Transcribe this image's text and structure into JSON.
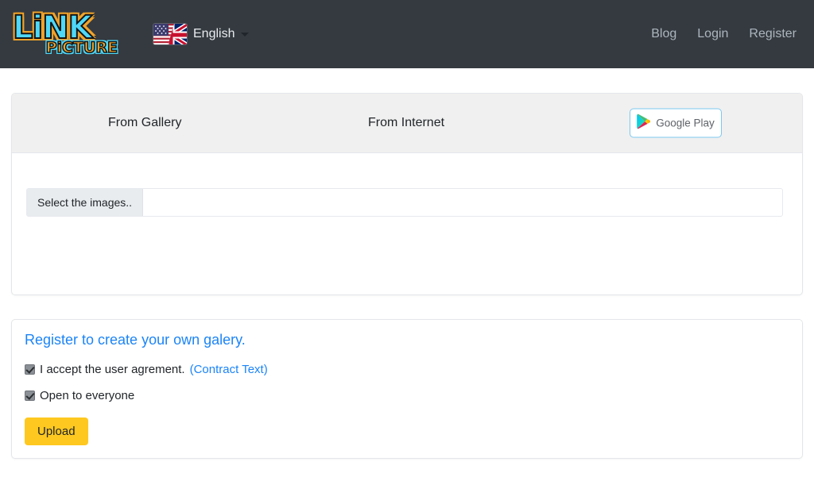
{
  "header": {
    "brand": {
      "link_text": "LiNK",
      "picture_text": "PiCTURE"
    },
    "language": {
      "label": "English",
      "flag_alt": "us-uk-flag-icon"
    },
    "nav": [
      {
        "label": "Blog"
      },
      {
        "label": "Login"
      },
      {
        "label": "Register"
      }
    ]
  },
  "upload_card": {
    "tabs": [
      {
        "label": "From Gallery"
      },
      {
        "label": "From Internet"
      }
    ],
    "google_play": {
      "label": "Google Play"
    },
    "file_input": {
      "button_label": "Select the images..",
      "value": ""
    }
  },
  "register_card": {
    "title": "Register to create your own galery.",
    "agreement": {
      "label": "I accept the user agrement.",
      "link_label": "(Contract Text)",
      "checked": true
    },
    "open_to_everyone": {
      "label": "Open to everyone",
      "checked": true
    },
    "upload_button": {
      "label": "Upload"
    }
  },
  "colors": {
    "header_bg": "#343a40",
    "brand_cyan": "#4fd8f7",
    "brand_orange": "#f0a32a",
    "link_blue": "#1b84f7",
    "upload_yellow": "#ffc820",
    "tab_header_bg": "#f0f0f0"
  }
}
